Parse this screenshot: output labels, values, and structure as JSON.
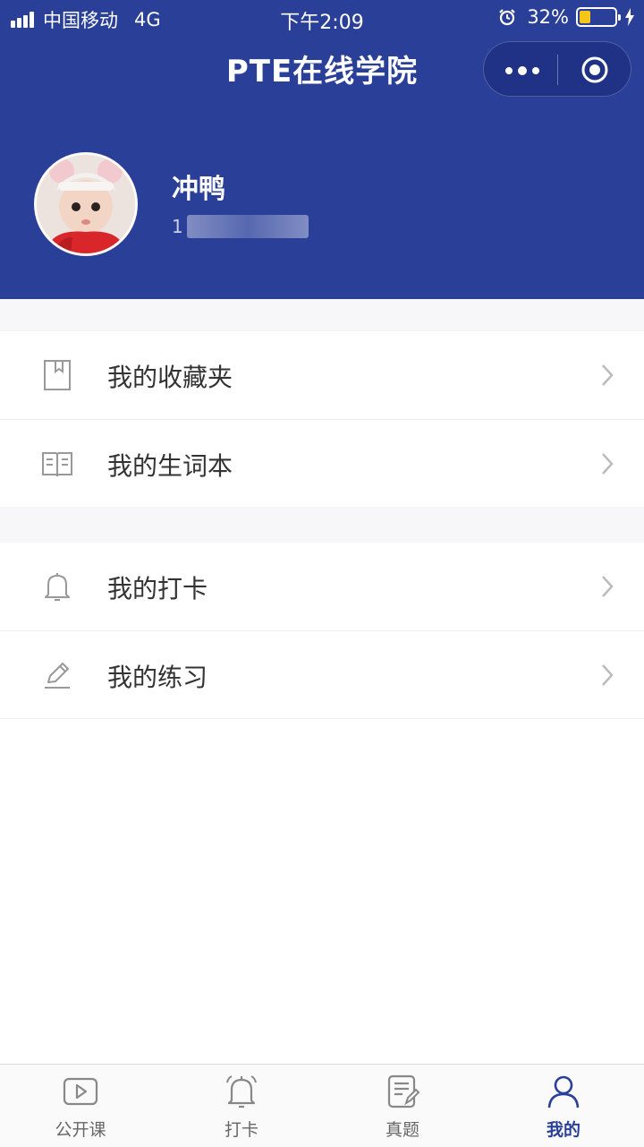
{
  "status_bar": {
    "carrier": "中国移动",
    "network": "4G",
    "time": "下午2:09",
    "battery": "32%",
    "battery_level": 0.32
  },
  "nav": {
    "title": "PTE在线学院"
  },
  "profile": {
    "name": "冲鸭",
    "phone_visible": "1"
  },
  "menu_groups": [
    [
      {
        "label": "我的收藏夹",
        "icon": "bookmark-icon"
      },
      {
        "label": "我的生词本",
        "icon": "open-book-icon"
      }
    ],
    [
      {
        "label": "我的打卡",
        "icon": "bell-icon"
      },
      {
        "label": "我的练习",
        "icon": "pencil-icon"
      }
    ]
  ],
  "tabbar": {
    "tabs": [
      {
        "label": "公开课",
        "icon": "video-play-icon",
        "active": false
      },
      {
        "label": "打卡",
        "icon": "bell-icon",
        "active": false
      },
      {
        "label": "真题",
        "icon": "document-edit-icon",
        "active": false
      },
      {
        "label": "我的",
        "icon": "user-icon",
        "active": true
      }
    ]
  },
  "colors": {
    "header_bg": "#2a3f98",
    "active_tab": "#2a3f98",
    "battery_fill": "#f5c518"
  }
}
